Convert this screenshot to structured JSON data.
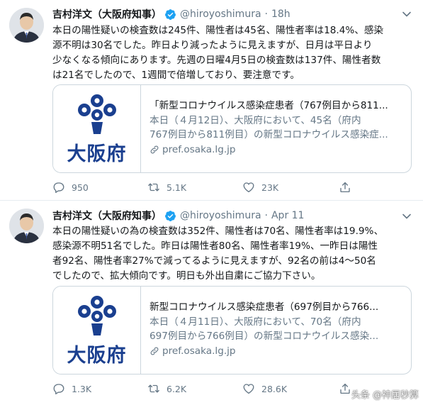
{
  "colors": {
    "text_primary": "#14171a",
    "text_secondary": "#657786",
    "verified_blue": "#1da1f2",
    "border": "#ccd6dd",
    "osaka_blue": "#1a3f8f"
  },
  "tweets": [
    {
      "author_name": "吉村洋文（大阪府知事）",
      "handle": "@hiroyoshimura",
      "separator": "·",
      "time": "18h",
      "verified_icon": "verified-badge-icon",
      "text_lines": [
        "本日の陽性疑いの検査数は245件、陽性者は45名、陽性者率は18.4%、感染",
        "源不明は30名でした。昨日より減ったように見えますが、日月は平日より",
        "少なくなる傾向にあります。先週の日曜4月5日の検査数は137件、陽性者数",
        "は21名でしたので、1週間で倍増しており、要注意です。"
      ],
      "card": {
        "image_text": "大阪府",
        "title": "「新型コロナウイルス感染症患者（767例目から811...",
        "desc_lines": [
          "本日（４月12日）、大阪府において、45名（府内",
          "767例目から811例目）の新型コロナウイルス感染症..."
        ],
        "link": "pref.osaka.lg.jp"
      },
      "actions": {
        "reply_count": "950",
        "retweet_count": "5.1K",
        "like_count": "23K"
      }
    },
    {
      "author_name": "吉村洋文（大阪府知事）",
      "handle": "@hiroyoshimura",
      "separator": "·",
      "time": "Apr 11",
      "verified_icon": "verified-badge-icon",
      "text_lines": [
        "本日の陽性疑いの為の検査数は352件、陽性者は70名、陽性者率は19.9%、",
        "感染源不明51名でした。昨日は陽性者80名、陽性者率19%、一昨日は陽性",
        "者92名、陽性者率27%で減ってるように見えますが、92名の前は4〜50名",
        "でしたので、拡大傾向です。明日も外出自粛にご協力下さい。"
      ],
      "card": {
        "image_text": "大阪府",
        "title": "新型コロナウイルス感染症患者（697例目から766...",
        "desc_lines": [
          "本日（４月11日）、大阪府において、70名（府内",
          "697例目から766例目）の新型コロナウイルス感染..."
        ],
        "link": "pref.osaka.lg.jp"
      },
      "actions": {
        "reply_count": "1.3K",
        "retweet_count": "6.2K",
        "like_count": "28.6K"
      }
    }
  ],
  "watermark": "头条 @神居秒算"
}
